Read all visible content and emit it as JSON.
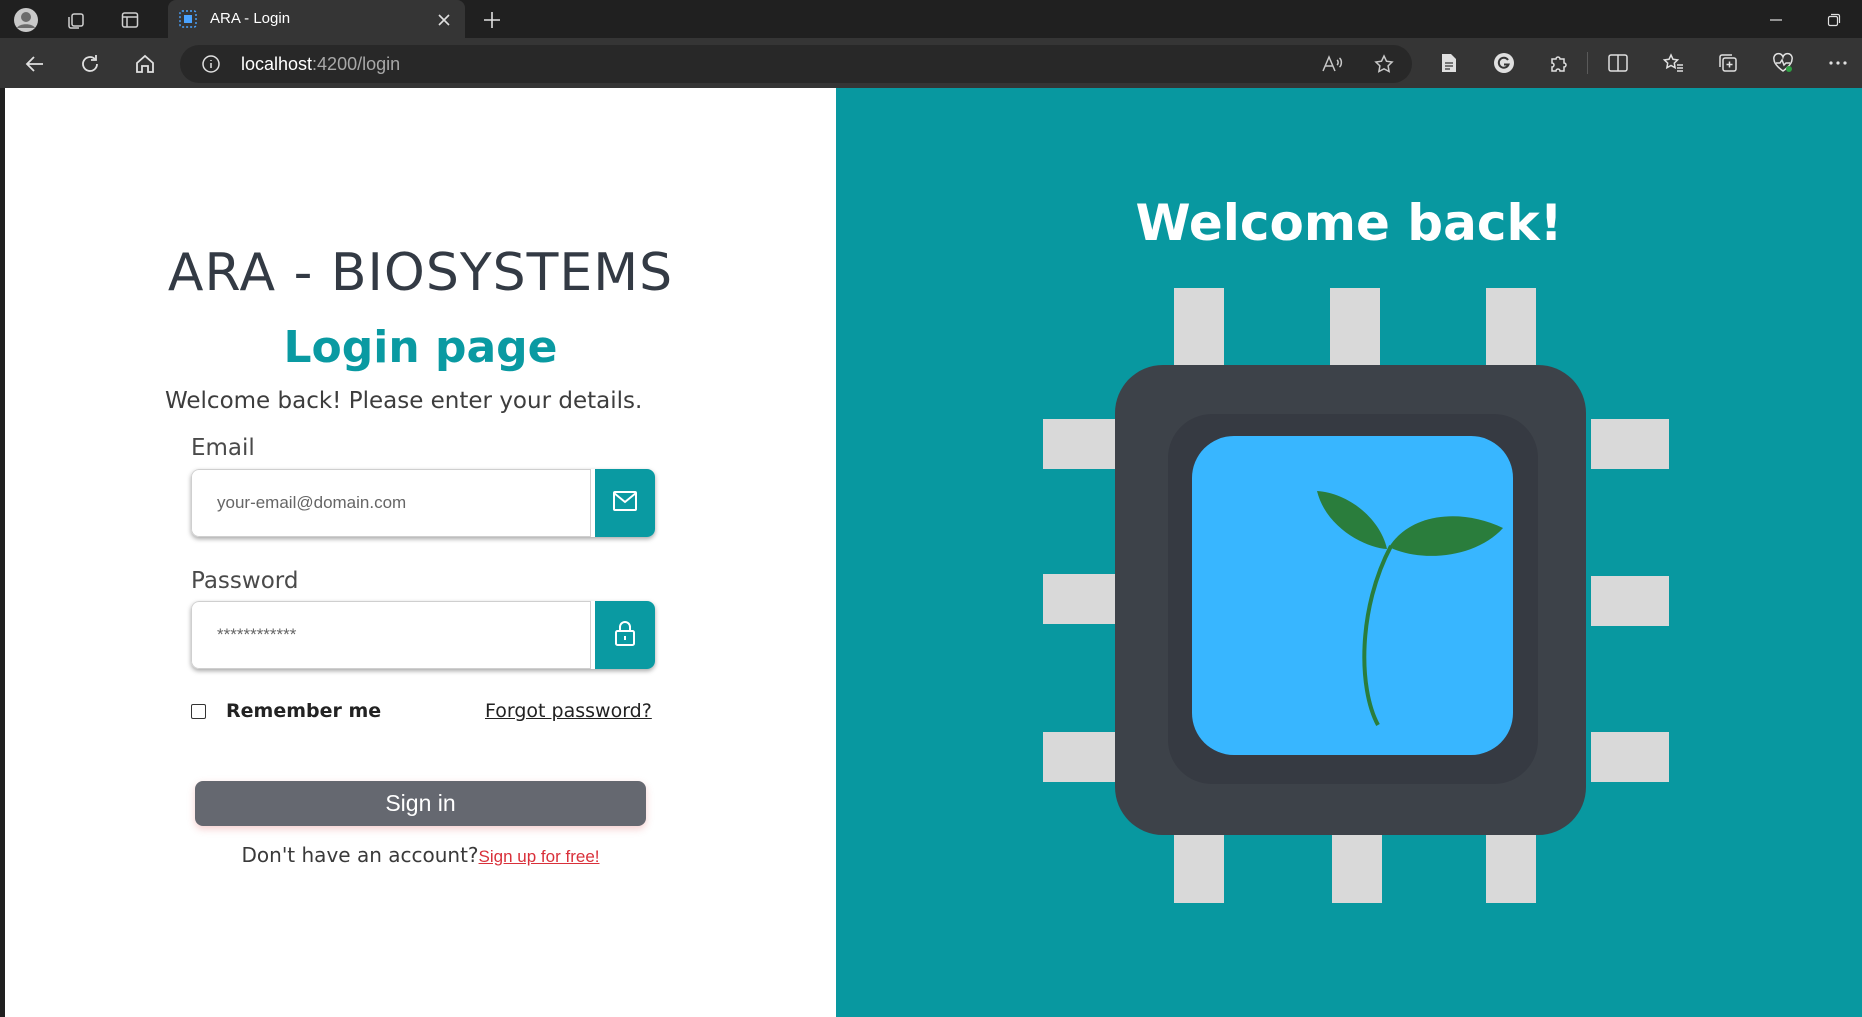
{
  "browser": {
    "tab_title": "ARA - Login",
    "url_host": "localhost",
    "url_path": ":4200/login",
    "icons": [
      "profile-icon",
      "workspaces-icon",
      "tab-actions-icon",
      "tab-favicon",
      "close-tab-icon",
      "new-tab-icon",
      "back-icon",
      "reload-icon",
      "home-icon",
      "site-info-icon",
      "read-aloud-icon",
      "favorite-star-icon",
      "extension-doc-icon",
      "grammarly-icon",
      "extensions-icon",
      "split-screen-icon",
      "favorites-icon",
      "collections-icon",
      "browser-essentials-icon",
      "more-menu-icon",
      "minimize-icon",
      "restore-icon"
    ]
  },
  "login": {
    "brand": "ARA - BIOSYSTEMS",
    "page_title": "Login page",
    "subtitle": "Welcome back! Please enter your details.",
    "email_label": "Email",
    "email_placeholder": "your-email@domain.com",
    "password_label": "Password",
    "password_placeholder": "************",
    "remember_label": "Remember me",
    "forgot_label": "Forgot password?",
    "signin_label": "Sign in",
    "no_account_text": "Don't have an account?",
    "signup_label": "Sign up for free!"
  },
  "hero": {
    "welcome": "Welcome back!",
    "illustration": "chip-with-sprout-icon"
  },
  "colors": {
    "accent": "#0a9aa2",
    "hero_bg": "#0898a0",
    "signin_bg": "#656870",
    "link_red": "#d9303a",
    "chip_body": "#3d4249",
    "chip_screen": "#38b6ff",
    "leaf": "#2a7d3c"
  }
}
